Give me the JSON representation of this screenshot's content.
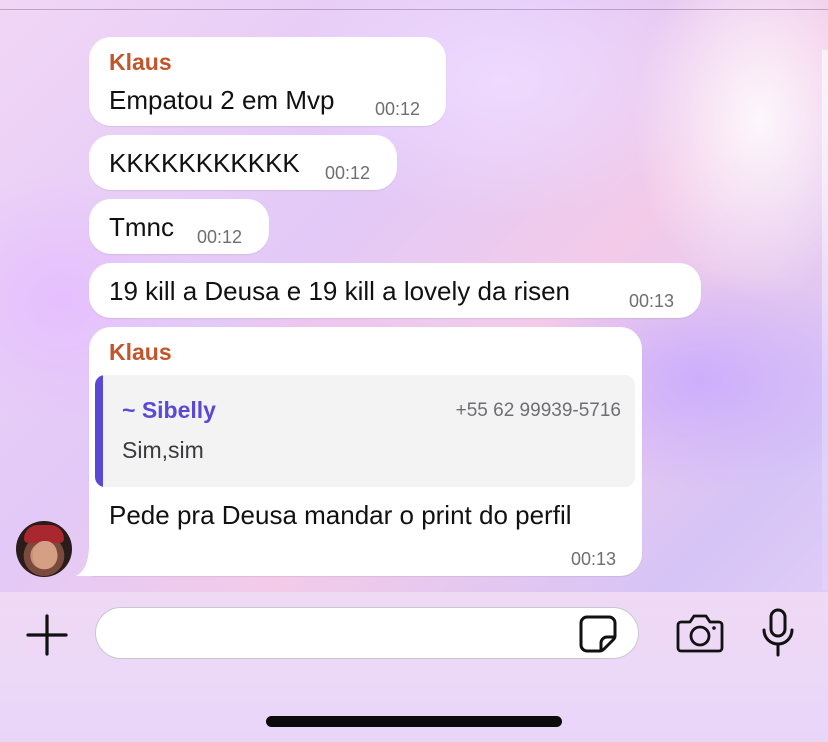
{
  "messages": [
    {
      "sender": "Klaus",
      "text": "Empatou 2 em Mvp",
      "time": "00:12"
    },
    {
      "text": "KKKKKKKKKKK",
      "time": "00:12"
    },
    {
      "text": "Tmnc",
      "time": "00:12"
    },
    {
      "text": "19 kill a Deusa e 19 kill a lovely da risen",
      "time": "00:13"
    },
    {
      "sender": "Klaus",
      "quote": {
        "name": "~ Sibelly",
        "phone": "+55 62 99939-5716",
        "text": "Sim,sim"
      },
      "text": "Pede pra Deusa mandar o print do perfil",
      "time": "00:13"
    }
  ],
  "composer": {
    "input_value": "",
    "icons": {
      "add": "plus-icon",
      "sticker": "sticker-icon",
      "camera": "camera-icon",
      "mic": "microphone-icon"
    }
  },
  "colors": {
    "sender_name": "#c2552b",
    "quote_accent": "#5a48d6",
    "bubble": "#ffffff"
  }
}
